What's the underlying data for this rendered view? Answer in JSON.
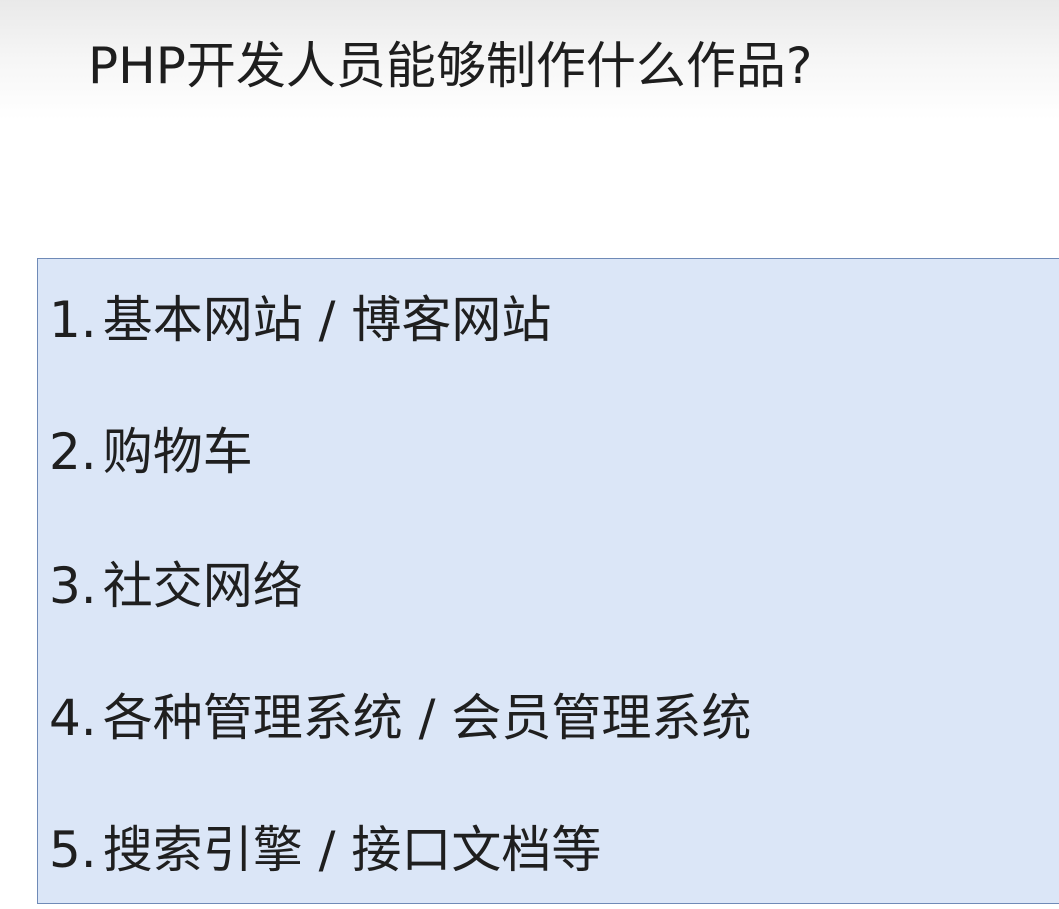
{
  "slide": {
    "title": "PHP开发人员能够制作什么作品?",
    "items": [
      {
        "number": "1.",
        "text": "基本网站 / 博客网站"
      },
      {
        "number": "2.",
        "text": "购物车"
      },
      {
        "number": "3.",
        "text": "社交网络"
      },
      {
        "number": "4.",
        "text": "各种管理系统 / 会员管理系统"
      },
      {
        "number": "5.",
        "text": "搜索引擎 / 接口文档等"
      }
    ]
  },
  "colors": {
    "box_background": "#dbe6f7",
    "box_border": "#6f8ab7",
    "text": "#1f1f1f"
  }
}
